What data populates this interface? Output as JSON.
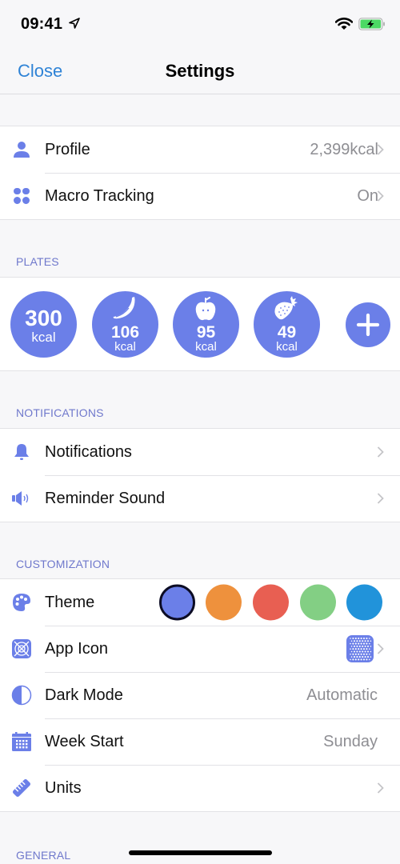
{
  "status_bar": {
    "time": "09:41",
    "icons": [
      "location-arrow-icon",
      "wifi-icon",
      "battery-charging-icon"
    ]
  },
  "nav": {
    "close_label": "Close",
    "title": "Settings"
  },
  "colors": {
    "accent": "#6b7fe8",
    "link": "#2f83d6",
    "section_header": "#6f78cc",
    "secondary_text": "#8e8e93",
    "battery_green": "#4cd964"
  },
  "account": {
    "rows": [
      {
        "icon": "person-icon",
        "label": "Profile",
        "value": "2,399kcal",
        "chevron": true
      },
      {
        "icon": "grid-dots-icon",
        "label": "Macro Tracking",
        "value": "On",
        "chevron": true
      }
    ]
  },
  "plates": {
    "header": "PLATES",
    "items": [
      {
        "icon": "none",
        "value": "300",
        "unit": "kcal"
      },
      {
        "icon": "banana-icon",
        "value": "106",
        "unit": "kcal"
      },
      {
        "icon": "apple-icon",
        "value": "95",
        "unit": "kcal"
      },
      {
        "icon": "strawberry-icon",
        "value": "49",
        "unit": "kcal"
      }
    ],
    "add_icon": "plus-icon"
  },
  "notifications": {
    "header": "NOTIFICATIONS",
    "rows": [
      {
        "icon": "bell-icon",
        "label": "Notifications",
        "chevron": true
      },
      {
        "icon": "speaker-icon",
        "label": "Reminder Sound",
        "chevron": true
      }
    ]
  },
  "customization": {
    "header": "CUSTOMIZATION",
    "theme": {
      "icon": "palette-icon",
      "label": "Theme",
      "swatches": [
        {
          "color": "#6b7fe8",
          "selected": true
        },
        {
          "color": "#ee913d",
          "selected": false
        },
        {
          "color": "#e85f52",
          "selected": false
        },
        {
          "color": "#83cf84",
          "selected": false
        },
        {
          "color": "#2193da",
          "selected": false
        }
      ]
    },
    "app_icon": {
      "icon": "app-icon-icon",
      "label": "App Icon",
      "chevron": true
    },
    "dark_mode": {
      "icon": "half-circle-icon",
      "label": "Dark Mode",
      "value": "Automatic"
    },
    "week_start": {
      "icon": "calendar-icon",
      "label": "Week Start",
      "value": "Sunday"
    },
    "units": {
      "icon": "ruler-icon",
      "label": "Units",
      "chevron": true
    }
  },
  "general": {
    "header": "GENERAL"
  }
}
